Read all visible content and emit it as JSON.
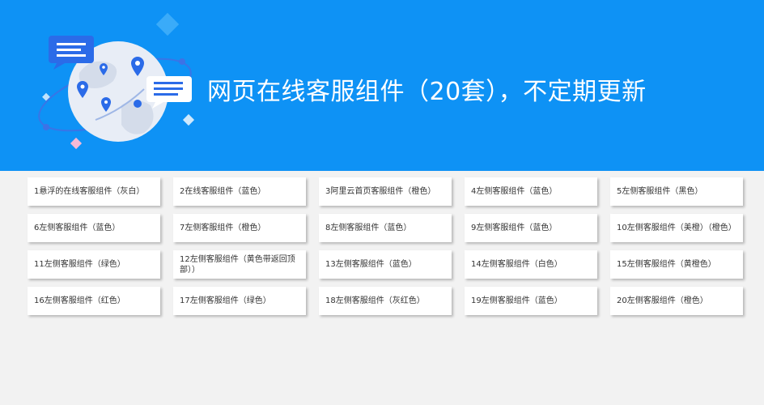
{
  "banner": {
    "title": "网页在线客服组件（20套），不定期更新",
    "background": "#0e92f5"
  },
  "components": [
    {
      "label": "1悬浮的在线客服组件（灰白）"
    },
    {
      "label": "2在线客服组件（蓝色）"
    },
    {
      "label": "3阿里云首页客服组件（橙色）"
    },
    {
      "label": "4左侧客服组件（蓝色）"
    },
    {
      "label": "5左侧客服组件（黑色）"
    },
    {
      "label": "6左侧客服组件（蓝色）"
    },
    {
      "label": "7左侧客服组件（橙色）"
    },
    {
      "label": "8左侧客服组件（蓝色）"
    },
    {
      "label": "9左侧客服组件（蓝色）"
    },
    {
      "label": "10左侧客服组件（美橙）（橙色）"
    },
    {
      "label": "11左侧客服组件（绿色）"
    },
    {
      "label": "12左侧客服组件（黄色带返回顶部））"
    },
    {
      "label": "13左侧客服组件（蓝色）"
    },
    {
      "label": "14左侧客服组件（白色）"
    },
    {
      "label": "15左侧客服组件（黄橙色）"
    },
    {
      "label": "16左侧客服组件（红色）"
    },
    {
      "label": "17左侧客服组件（绿色）"
    },
    {
      "label": "18左侧客服组件（灰红色）"
    },
    {
      "label": "19左侧客服组件（蓝色）"
    },
    {
      "label": "20左侧客服组件（橙色）"
    }
  ]
}
